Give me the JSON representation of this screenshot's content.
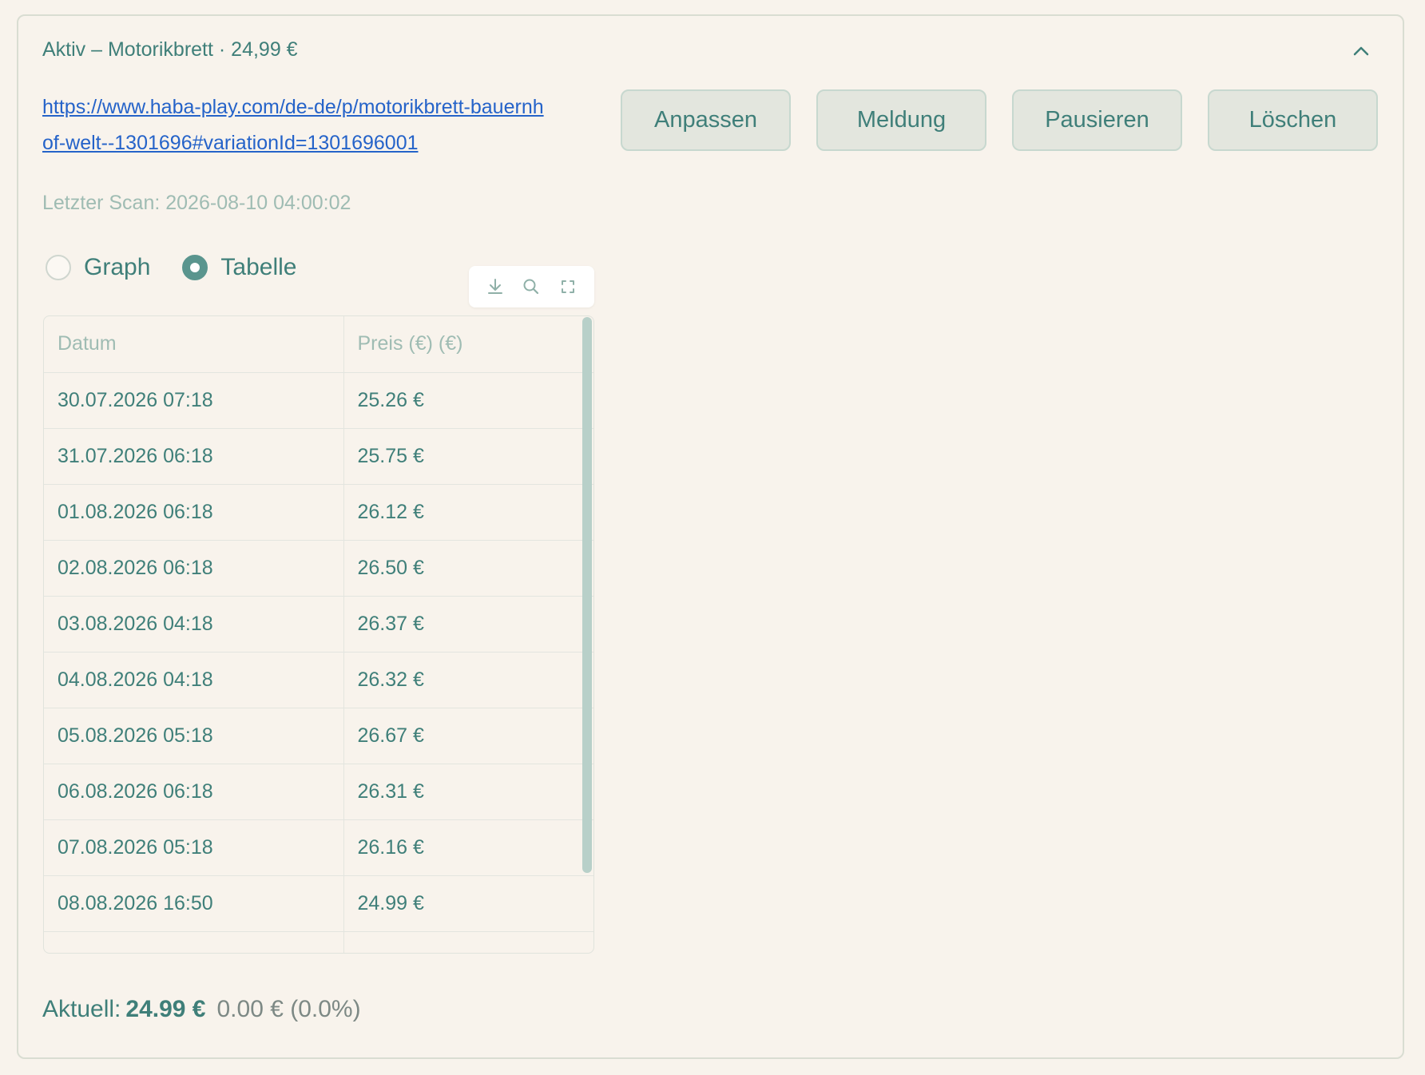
{
  "header": {
    "title": "Aktiv – Motorikbrett · 24,99 €"
  },
  "product": {
    "url": "https://www.haba-play.com/de-de/p/motorikbrett-bauernhof-welt--1301696#variationId=1301696001",
    "last_scan": "Letzter Scan: 2026-08-10 04:00:02"
  },
  "actions": {
    "adjust": "Anpassen",
    "notify": "Meldung",
    "pause": "Pausieren",
    "delete": "Löschen"
  },
  "view_toggle": {
    "graph_label": "Graph",
    "table_label": "Tabelle",
    "selected": "Tabelle"
  },
  "table": {
    "columns": [
      "Datum",
      "Preis (€) (€)"
    ],
    "rows": [
      [
        "30.07.2026 07:18",
        "25.26 €"
      ],
      [
        "31.07.2026 06:18",
        "25.75 €"
      ],
      [
        "01.08.2026 06:18",
        "26.12 €"
      ],
      [
        "02.08.2026 06:18",
        "26.50 €"
      ],
      [
        "03.08.2026 04:18",
        "26.37 €"
      ],
      [
        "04.08.2026 04:18",
        "26.32 €"
      ],
      [
        "05.08.2026 05:18",
        "26.67 €"
      ],
      [
        "06.08.2026 06:18",
        "26.31 €"
      ],
      [
        "07.08.2026 05:18",
        "26.16 €"
      ],
      [
        "08.08.2026 16:50",
        "24.99 €"
      ],
      [
        "",
        ""
      ]
    ]
  },
  "summary": {
    "label": "Aktuell:",
    "current": "24.99 €",
    "change": "0.00 € (0.0%)"
  },
  "colors": {
    "accent": "#3f7f79",
    "link": "#2563c9",
    "background": "#f8f3ec",
    "button_bg": "#e3e6de",
    "muted": "#9fbcb3"
  }
}
